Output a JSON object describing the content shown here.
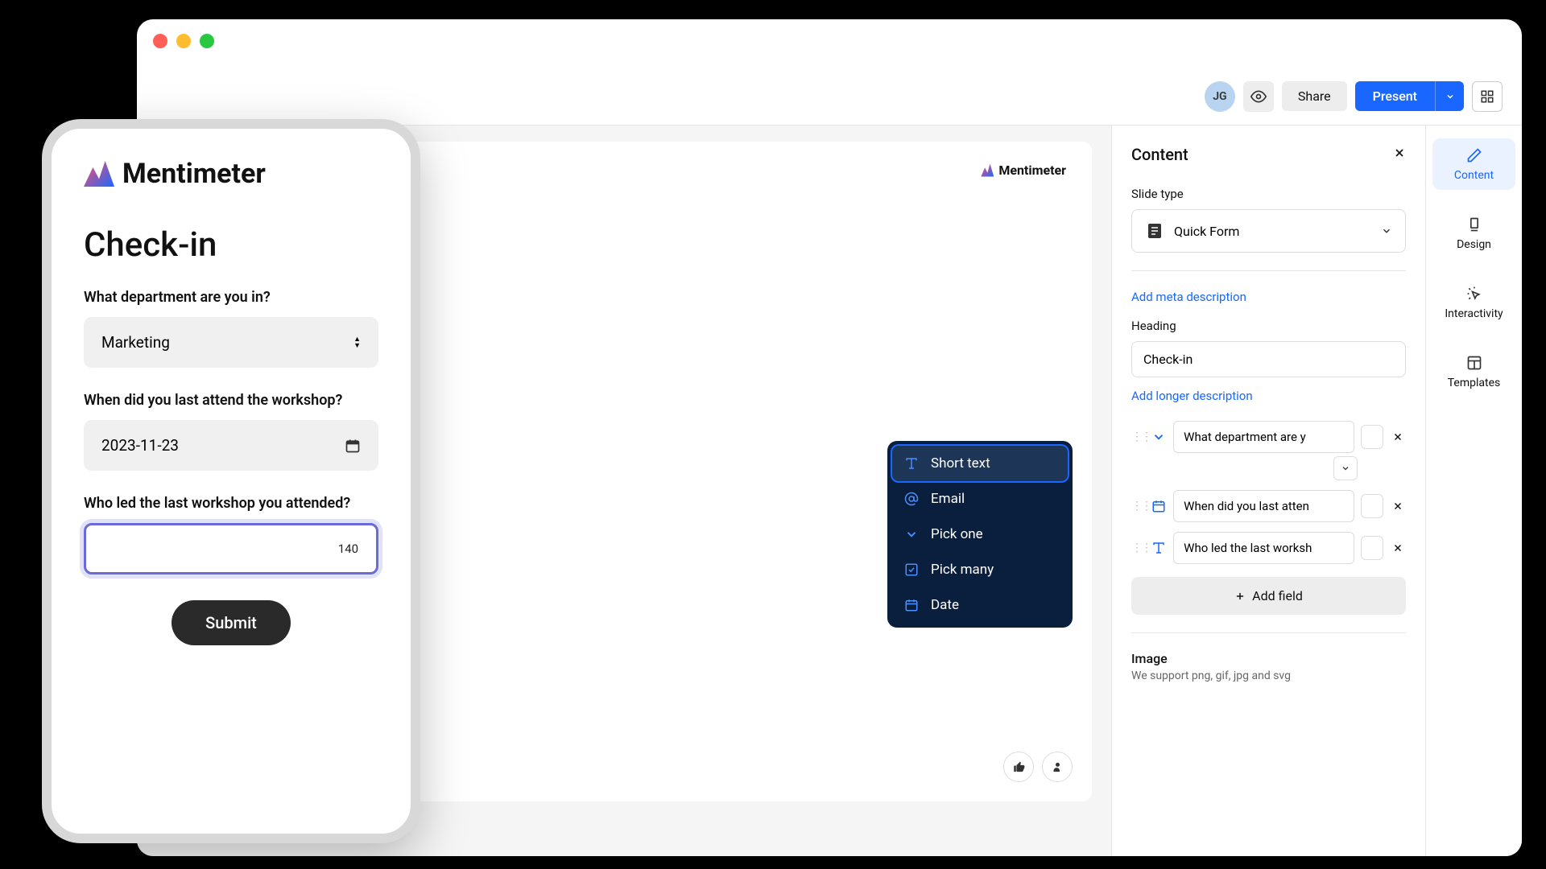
{
  "toolbar": {
    "avatar_initials": "JG",
    "share_label": "Share",
    "present_label": "Present"
  },
  "slide": {
    "brand": "Mentimeter",
    "heading": "Check-in"
  },
  "content_panel": {
    "title": "Content",
    "slide_type_label": "Slide type",
    "slide_type_value": "Quick Form",
    "meta_link": "Add meta description",
    "heading_label": "Heading",
    "heading_value": "Check-in",
    "longer_link": "Add longer description",
    "fields": [
      {
        "label": "What department are you in?",
        "type": "pick-one"
      },
      {
        "label": "When did you last attend the workshop?",
        "type": "date"
      },
      {
        "label": "Who led the last workshop you attended?",
        "type": "text"
      }
    ],
    "field_display": {
      "0": "What department are y",
      "1": "When did you last atten",
      "2": "Who led the last worksh"
    },
    "add_field_label": "Add field",
    "image_title": "Image",
    "image_subtitle": "We support png, gif, jpg and svg"
  },
  "rail": {
    "content": "Content",
    "design": "Design",
    "interactivity": "Interactivity",
    "templates": "Templates"
  },
  "field_type_menu": {
    "short_text": "Short text",
    "email": "Email",
    "pick_one": "Pick one",
    "pick_many": "Pick many",
    "date": "Date"
  },
  "phone": {
    "brand": "Mentimeter",
    "title": "Check-in",
    "q1_label": "What department are you in?",
    "q1_value": "Marketing",
    "q2_label": "When did you last attend the workshop?",
    "q2_value": "2023-11-23",
    "q3_label": "Who led the last workshop you attended?",
    "q3_charcount": "140",
    "submit_label": "Submit"
  }
}
